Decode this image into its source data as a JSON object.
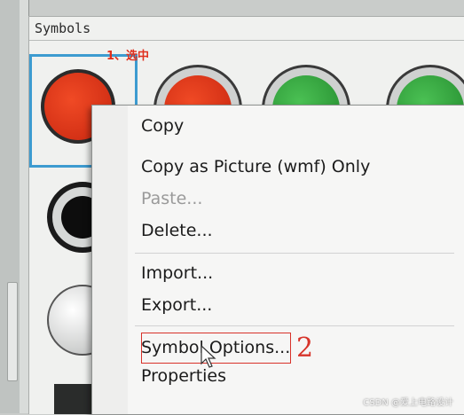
{
  "panel": {
    "title": "Symbols"
  },
  "annotations": {
    "step1": "1、选中",
    "step2": "2"
  },
  "context_menu": {
    "items": [
      {
        "label": "Copy",
        "enabled": true
      },
      {
        "label": "Copy as Picture (wmf) Only",
        "enabled": true
      },
      {
        "label": "Paste...",
        "enabled": false
      },
      {
        "label": "Delete...",
        "enabled": true
      },
      {
        "label": "Import...",
        "enabled": true
      },
      {
        "label": "Export...",
        "enabled": true
      },
      {
        "label": "Symbol Options...",
        "enabled": true,
        "highlighted": true
      },
      {
        "label": "Properties",
        "enabled": true
      }
    ]
  },
  "symbols": [
    {
      "name": "red-button-selected",
      "color": "#e0361b",
      "selected": true
    },
    {
      "name": "red-button",
      "color": "#e0361b"
    },
    {
      "name": "green-button",
      "color": "#2fa13a"
    },
    {
      "name": "green-button-2",
      "color": "#2fa13a"
    },
    {
      "name": "black-button",
      "color": "#111111"
    },
    {
      "name": "white-button",
      "color": "#e8e8e8"
    }
  ],
  "colors": {
    "selection": "#3d9bd0",
    "annotation": "#d7342a"
  },
  "watermark": "CSDN @爱上电路设计"
}
